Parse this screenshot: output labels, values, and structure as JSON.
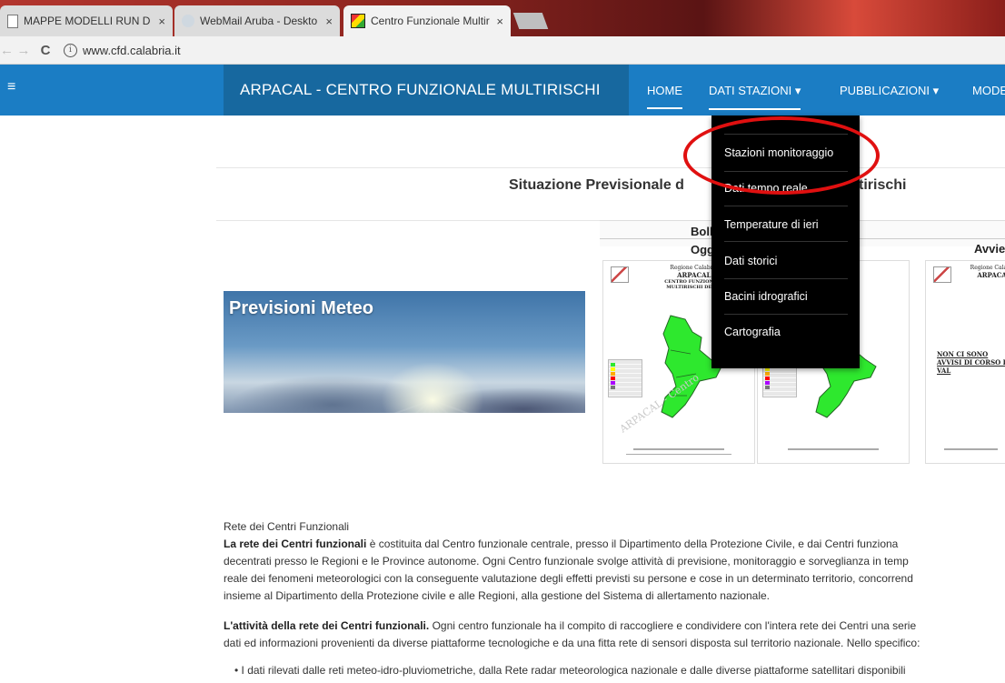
{
  "browser": {
    "tabs": [
      {
        "label": "MAPPE MODELLI RUN D",
        "close": "×"
      },
      {
        "label": "WebMail Aruba - Deskto",
        "close": "×"
      },
      {
        "label": "Centro Funzionale Multir",
        "close": "×"
      }
    ],
    "url": "www.cfd.calabria.it",
    "info": "i",
    "back": "←",
    "forward": "→",
    "reload": "C"
  },
  "navbar": {
    "menu_icon": "≡",
    "brand": "ARPACAL - CENTRO FUNZIONALE MULTIRISCHI",
    "items": [
      {
        "label": "HOME"
      },
      {
        "label": "DATI STAZIONI ▾"
      },
      {
        "label": "PUBBLICAZIONI ▾"
      },
      {
        "label": "MODE"
      }
    ]
  },
  "dropdown": {
    "items": [
      {
        "label": "Stazioni monitoraggio"
      },
      {
        "label": "Dati tempo reale"
      },
      {
        "label": "Temperature di ieri"
      },
      {
        "label": "Dati storici"
      },
      {
        "label": "Bacini idrografici"
      },
      {
        "label": "Cartografia"
      }
    ]
  },
  "main": {
    "title_left": "Situazione Previsionale d",
    "title_right": "tirischi",
    "meteo_label": "Previsioni Meteo",
    "bollettini_title": "Bollettin",
    "oggi_label": "Oggi",
    "avvisi_label": "Avvie",
    "bulletin": {
      "region": "Regione Calabria",
      "org": "ARPACAL",
      "center": "CENTRO FUNZIONALE MULTIRISCHI DELLA",
      "watermark": "ARPACAL - Centro",
      "no_avvisi": "NON CI SONO AVVISI DI CORSO DI VAL"
    }
  },
  "article": {
    "heading": "Rete dei Centri Funzionali",
    "p1_bold": "La rete dei Centri funzionali",
    "p1_l1": " è costituita dal Centro funzionale centrale, presso il Dipartimento della Protezione Civile, e dai Centri funziona",
    "p1_l2": "decentrati presso le Regioni e le Province autonome. Ogni Centro funzionale svolge attività di previsione, monitoraggio e sorveglianza in temp",
    "p1_l3": "reale dei fenomeni meteorologici con la conseguente valutazione degli effetti previsti su persone e cose in un determinato territorio, concorrend",
    "p1_l4": "insieme al Dipartimento della Protezione civile e alle Regioni, alla gestione del Sistema di allertamento nazionale.",
    "p2_bold": "L'attività della rete dei Centri funzionali.",
    "p2_l1": " Ogni centro funzionale ha il compito di raccogliere e condividere con l'intera rete dei Centri una serie",
    "p2_l2": "dati ed informazioni provenienti da diverse piattaforme tecnologiche e da una fitta rete di sensori disposta sul territorio nazionale. Nello specifico:",
    "bullet1": "• I dati rilevati dalle reti meteo-idro-pluviometriche, dalla Rete radar meteorologica nazionale e dalle diverse piattaforme satellitari disponibili"
  },
  "colors": {
    "navbar": "#1b7dc4",
    "brand_box": "#17689f",
    "dropdown": "#000000",
    "annotation": "#e01010",
    "map_green": "#2ee82e"
  }
}
